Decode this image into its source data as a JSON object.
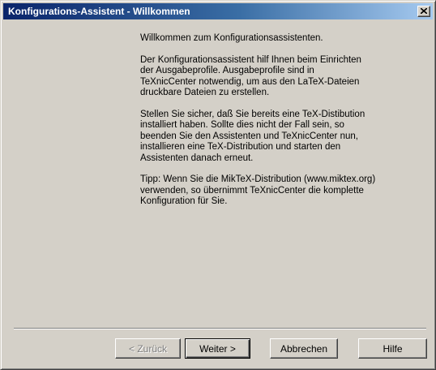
{
  "window": {
    "title": "Konfigurations-Assistent - Willkommen"
  },
  "content": {
    "paragraphs": [
      "Willkommen zum Konfigurationsassistenten.",
      "Der Konfigurationsassistent hilf Ihnen beim Einrichten\nder Ausgabeprofile. Ausgabeprofile sind in\nTeXnicCenter notwendig, um aus den LaTeX-Dateien\ndruckbare Dateien zu erstellen.",
      "Stellen Sie sicher, daß Sie bereits eine TeX-Distibution\ninstalliert haben. Sollte dies nicht der Fall sein, so\nbeenden Sie den Assistenten und TeXnicCenter nun,\ninstallieren eine TeX-Distribution und starten den\nAssistenten danach erneut.",
      "Tipp: Wenn Sie die MikTeX-Distribution (www.miktex.org)\nverwenden, so übernimmt TeXnicCenter die komplette\nKonfiguration für Sie."
    ]
  },
  "buttons": {
    "back": "< Zurück",
    "next": "Weiter >",
    "cancel": "Abbrechen",
    "help": "Hilfe"
  },
  "colors": {
    "titlebar_start": "#0a246a",
    "titlebar_end": "#a6caf0",
    "face": "#d4d0c8"
  },
  "icons": {
    "close": "close-icon"
  }
}
